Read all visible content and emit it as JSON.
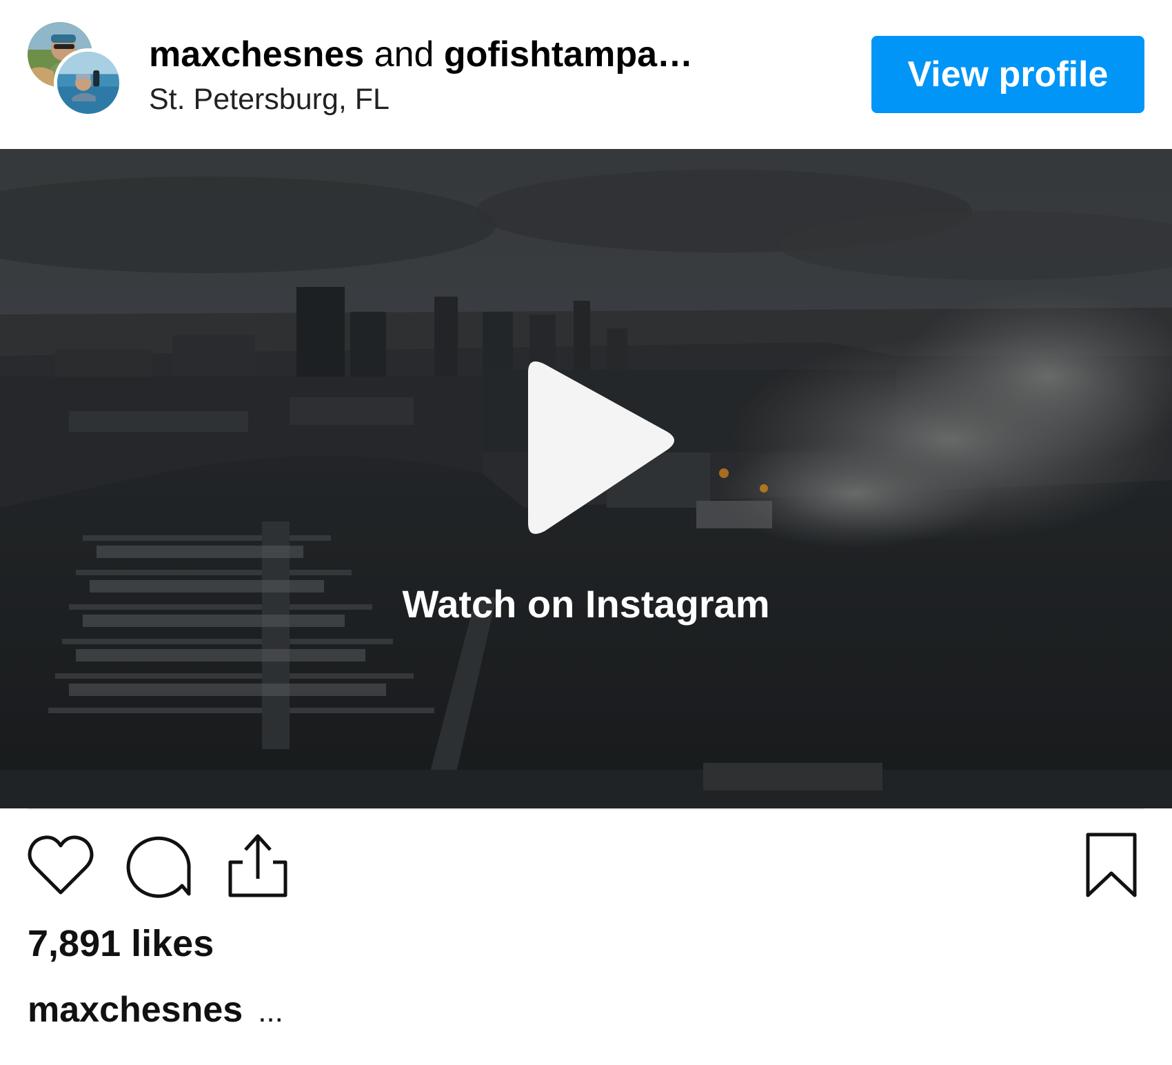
{
  "header": {
    "owner": "maxchesnes",
    "joiner": "and",
    "collaborator": "gofishtampa…",
    "location": "St. Petersburg, FL",
    "view_profile_label": "View profile"
  },
  "media": {
    "watch_label": "Watch on Instagram",
    "play_icon": "play-icon"
  },
  "actions": {
    "like_icon": "heart-icon",
    "comment_icon": "comment-icon",
    "share_icon": "share-icon",
    "save_icon": "bookmark-icon"
  },
  "stats": {
    "likes": "7,891 likes"
  },
  "caption": {
    "user": "maxchesnes",
    "more": "..."
  },
  "colors": {
    "accent": "#0095f6",
    "text": "#000000",
    "divider": "#e6e6e6"
  }
}
